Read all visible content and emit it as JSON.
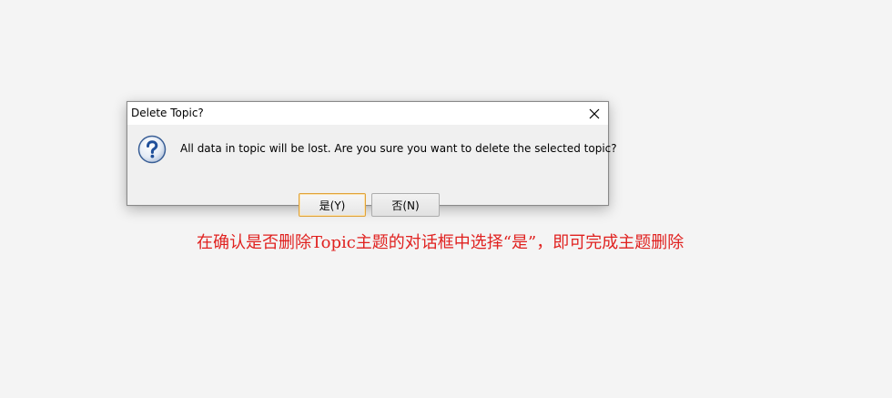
{
  "dialog": {
    "title": "Delete Topic?",
    "message": "All data in topic will be lost. Are you sure you want to delete the selected topic?",
    "icon": "question-icon",
    "yes_label": "是(Y)",
    "no_label": "否(N)",
    "close_icon": "close-icon"
  },
  "annotation": {
    "text": "在确认是否删除Topic主题的对话框中选择“是”，即可完成主题删除",
    "color": "#e0211f"
  },
  "colors": {
    "background": "#f4f4f4",
    "dialog_body": "#f0f0f0",
    "titlebar": "#ffffff",
    "default_button_border": "#e0a33a",
    "icon_blue": "#1f4f9a"
  }
}
